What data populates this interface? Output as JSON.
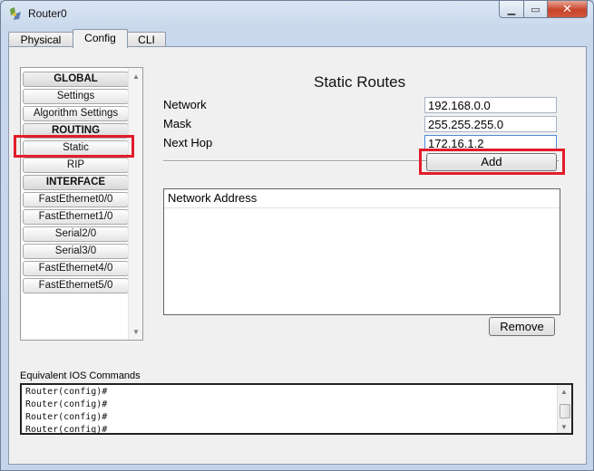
{
  "window": {
    "title": "Router0"
  },
  "tabs": [
    {
      "label": "Physical"
    },
    {
      "label": "Config"
    },
    {
      "label": "CLI"
    }
  ],
  "sidebar": {
    "items": [
      {
        "label": "GLOBAL",
        "header": true
      },
      {
        "label": "Settings"
      },
      {
        "label": "Algorithm Settings"
      },
      {
        "label": "ROUTING",
        "header": true
      },
      {
        "label": "Static"
      },
      {
        "label": "RIP"
      },
      {
        "label": "INTERFACE",
        "header": true
      },
      {
        "label": "FastEthernet0/0"
      },
      {
        "label": "FastEthernet1/0"
      },
      {
        "label": "Serial2/0"
      },
      {
        "label": "Serial3/0"
      },
      {
        "label": "FastEthernet4/0"
      },
      {
        "label": "FastEthernet5/0"
      }
    ]
  },
  "static_routes": {
    "title": "Static Routes",
    "network_label": "Network",
    "network_value": "192.168.0.0",
    "mask_label": "Mask",
    "mask_value": "255.255.255.0",
    "next_hop_label": "Next Hop",
    "next_hop_value": "172.16.1.2",
    "add_label": "Add",
    "list_header": "Network Address",
    "remove_label": "Remove"
  },
  "ios": {
    "label": "Equivalent IOS Commands",
    "lines": [
      "Router(config)#",
      "Router(config)#",
      "Router(config)#",
      "Router(config)#"
    ]
  },
  "colors": {
    "highlight": "#e21d2b",
    "close_button": "#c7432a"
  }
}
